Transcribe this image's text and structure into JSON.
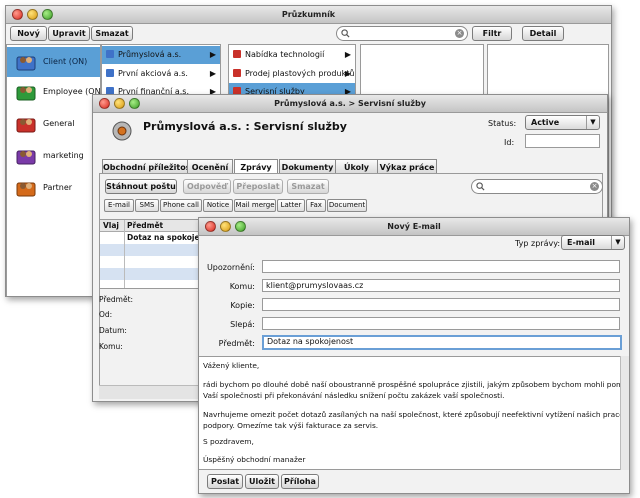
{
  "main": {
    "title": "Průzkumník",
    "toolbar": {
      "new": "Nový",
      "edit": "Upravit",
      "delete": "Smazat",
      "filter": "Filtr",
      "detail": "Detail"
    },
    "categories": [
      {
        "label": "Client (ON)",
        "color": "#3f72c8"
      },
      {
        "label": "Employee (ON)",
        "color": "#2e9a3a"
      },
      {
        "label": "General",
        "color": "#c9312a"
      },
      {
        "label": "marketing",
        "color": "#7a3aa8"
      },
      {
        "label": "Partner",
        "color": "#d46a1a"
      }
    ],
    "companies": [
      "Průmyslová a.s.",
      "První akciová a.s.",
      "První finanční a.s."
    ],
    "services": [
      "Nabídka technologií",
      "Prodej plastových produktů",
      "Servisní služby"
    ],
    "list_header": {
      "col1": "Vlaj",
      "col2": "Předmět"
    },
    "list_rows": [
      {
        "subject": "Dotaz na spokojenost"
      }
    ],
    "detail_labels": {
      "subject": "Předmět:",
      "from": "Od:",
      "date": "Datum:",
      "to": "Komu:"
    }
  },
  "company": {
    "title": "Průmyslová a.s. > Servisní služby",
    "heading": "Průmyslová a.s. : Servisní služby",
    "status_label": "Status:",
    "status_value": "Active",
    "id_label": "Id:",
    "tabs": [
      "Obchodní příležitost",
      "Ocenění",
      "Zprávy",
      "Dokumenty",
      "Úkoly",
      "Výkaz práce"
    ],
    "actions": {
      "download": "Stáhnout poštu",
      "reply": "Odpověď",
      "forward": "Přeposlat",
      "delete": "Smazat"
    },
    "types": [
      "E-mail",
      "SMS",
      "Phone call",
      "Notice",
      "Mail merge",
      "Latter",
      "Fax",
      "Document"
    ]
  },
  "email": {
    "title": "Nový E-mail",
    "type_label": "Typ zprávy:",
    "type_value": "E-mail",
    "fields": {
      "notify": "Upozornění:",
      "to": "Komu:",
      "copy": "Kopie:",
      "bcc": "Slepá:",
      "subject": "Předmět:"
    },
    "values": {
      "to": "klient@prumyslovaas.cz",
      "subject": "Dotaz na spokojenost"
    },
    "body": [
      "Vážený kliente,",
      "",
      "rádi bychom po dlouhé době naší oboustranně prospěšné spolupráce zjistili, jakým způsobem bychom mohli pomoci",
      "Vaší společnosti při překonávání následku snížení počtu zakázek vaší společnosti.",
      "",
      "Navrhujeme omezit počet dotazů zasílaných na naší společnost, které způsobují neefektivní vytížení našich pracovníků",
      "podpory. Omezíme tak výši fakturace za servis.",
      "",
      "S pozdravem,",
      "",
      "Úspěšný obchodní manažer"
    ],
    "buttons": {
      "send": "Poslat",
      "save": "Uložit",
      "attach": "Příloha"
    }
  }
}
